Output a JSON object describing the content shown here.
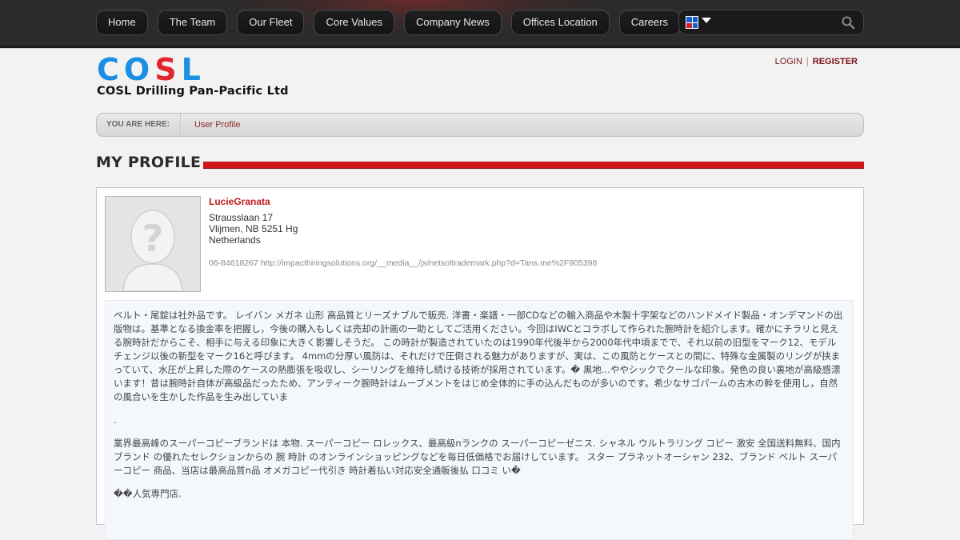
{
  "nav": {
    "items": [
      "Home",
      "The Team",
      "Our Fleet",
      "Core Values",
      "Company News",
      "Offices Location",
      "Careers"
    ]
  },
  "search": {
    "icon": "search-icon",
    "language_icon": "language-flag-icon"
  },
  "brand": {
    "logo_letters": [
      "C",
      "O",
      "S",
      "L"
    ],
    "logo_colors": [
      "#1a8fe3",
      "#1a8fe3",
      "#e3262c",
      "#1a8fe3"
    ],
    "company_name": "COSL Drilling Pan-Pacific Ltd"
  },
  "auth": {
    "login": "LOGIN",
    "separator": "|",
    "register": "REGISTER"
  },
  "breadcrumb": {
    "label": "YOU ARE HERE:",
    "current": "User Profile"
  },
  "page": {
    "title": "MY PROFILE",
    "accent_color": "#d0151b"
  },
  "profile": {
    "username": "LucieGranata",
    "address_line1": "Strausslaan 17",
    "address_line2": "Vlijmen, NB 5251 Hg",
    "country": "Netherlands",
    "contact": "06-84618267 http://impacthiringsolutions.org/__media__/js/netsoltrademark.php?d=Tans.me%2F905398",
    "avatar_icon": "placeholder-avatar-icon"
  },
  "bio": {
    "p1": "ベルト・尾錠は社外品です。 レイバン メガネ 山形 高品質とリーズナブルで販売. 洋書・楽譜・一部CDなどの輸入商品や木製十字架などのハンドメイド製品・オンデマンドの出版物は。基準となる換金率を把握し，今後の購入もしくは売却の計画の一助としてご活用ください。今回はIWCとコラボして作られた腕時計を紹介します。確かにチラリと見える腕時計だからこそ、相手に与える印象に大きく影響しそうだ。 この時計が製造されていたのは1990年代後半から2000年代中頃までで、それ以前の旧型をマーク12、モデルチェンジ以後の新型をマーク16と呼びます。 4mmの分厚い風防は、それだけで圧倒される魅力がありますが、実は、この風防とケースとの間に、特殊な金属製のリングが挟まっていて、水圧が上昇した際のケースの熱膨張を吸収し、シーリングを維持し続ける技術が採用されています。� 黒地...ややシックでクールな印象。発色の良い裏地が高級感漂います！昔は腕時計自体が高級品だったため、アンティーク腕時計はムーブメントをはじめ全体的に手の込んだものが多いのです。希少なサゴパームの古木の幹を使用し，自然の風合いを生かした作品を生み出していま",
    "p2": ".",
    "p3": "業界最高峰のスーパーコピーブランドは 本物. スーパーコピー ロレックス、最高級nランクの スーパーコピーゼニス. シャネル ウルトラリング コピー 激安 全国送料無料、国内ブランド の優れたセレクションからの 腕 時計 のオンラインショッピングなどを毎日低価格でお届けしています。 スター プラネットオーシャン 232、ブランド ベルト スーパーコピー 商品、当店は最高品質n品 オメガコピー代引き 時計着払い対応安全通販後払 口コミ い�",
    "p4": "��人気専門店."
  }
}
